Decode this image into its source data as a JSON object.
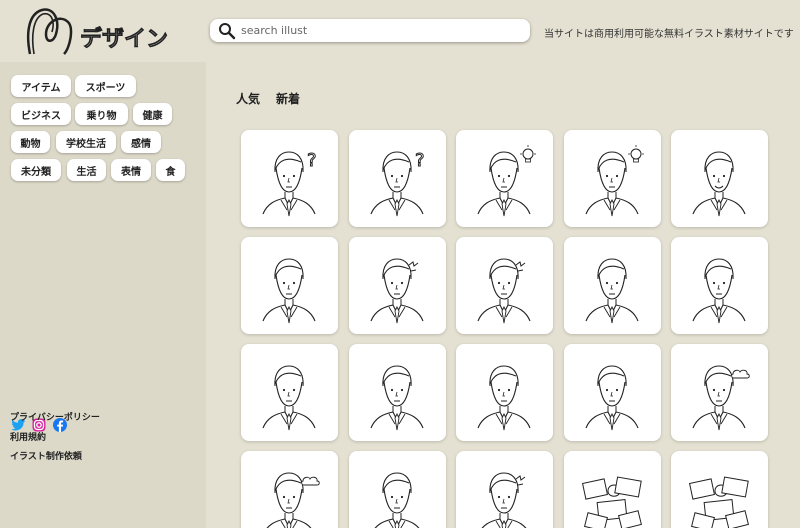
{
  "header": {
    "logo_text": "デザイン",
    "search_placeholder": "search illust",
    "tagline": "当サイトは商用利用可能な無料イラスト素材サイトです"
  },
  "sidebar": {
    "tags": [
      "アイテム",
      "スポーツ",
      "ビジネス",
      "乗り物",
      "健康",
      "動物",
      "学校生活",
      "感情",
      "未分類",
      "生活",
      "表情",
      "食"
    ],
    "social": [
      "twitter-icon",
      "instagram-icon",
      "facebook-icon"
    ],
    "footer_links": [
      "プライバシーポリシー",
      "利用規約",
      "イラスト制作依頼"
    ]
  },
  "main": {
    "tabs": [
      "人気",
      "新着"
    ],
    "cards": [
      {
        "accessory": "question"
      },
      {
        "accessory": "question"
      },
      {
        "accessory": "bulb"
      },
      {
        "accessory": "bulb"
      },
      {
        "accessory": "smile"
      },
      {
        "accessory": "none"
      },
      {
        "accessory": "stress"
      },
      {
        "accessory": "stress"
      },
      {
        "accessory": "none"
      },
      {
        "accessory": "none"
      },
      {
        "accessory": "none"
      },
      {
        "accessory": "none"
      },
      {
        "accessory": "none"
      },
      {
        "accessory": "none"
      },
      {
        "accessory": "cloud"
      },
      {
        "accessory": "cloud"
      },
      {
        "accessory": "none"
      },
      {
        "accessory": "stress"
      },
      {
        "accessory": "papers"
      },
      {
        "accessory": "papers"
      }
    ]
  },
  "colors": {
    "header_bg": "#e4e1d2",
    "sidebar_bg": "#dcd9c9",
    "twitter": "#1da1f2",
    "facebook": "#1877f2",
    "instagram": "#d6249f"
  }
}
